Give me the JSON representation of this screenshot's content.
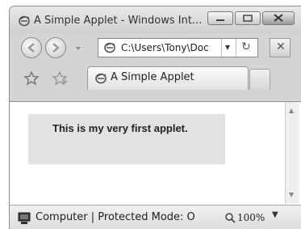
{
  "window": {
    "title": "A Simple Applet - Windows Int..."
  },
  "address_bar": {
    "value": "C:\\Users\\Tony\\Doc",
    "dropdown_glyph": "▾",
    "refresh_glyph": "↻",
    "stop_glyph": "✕"
  },
  "tabs": [
    {
      "label": "A Simple Applet"
    }
  ],
  "content": {
    "applet_text": "This is my very first applet."
  },
  "status_bar": {
    "zone": "Computer | Protected Mode: O",
    "zoom": "100%",
    "zoom_caret": "▼"
  },
  "icons": {
    "page_icon": "ie-page-icon",
    "favorites": "star-icon",
    "add_favorites": "add-favorites-icon",
    "computer": "computer-icon",
    "zoom": "magnifier-icon"
  },
  "colors": {
    "chrome": "#d4d4d4",
    "applet_bg": "#e2e2e2",
    "content_bg": "#ffffff"
  }
}
